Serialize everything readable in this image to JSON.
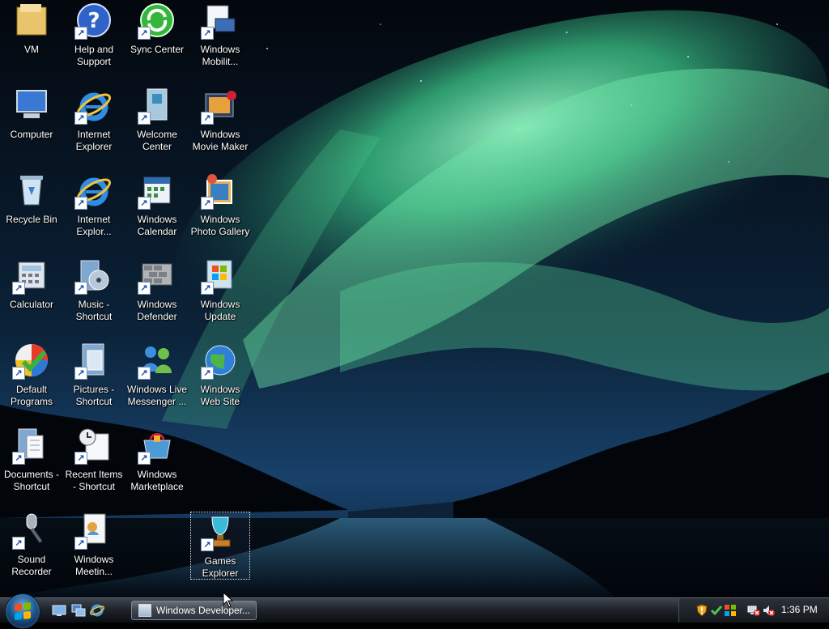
{
  "desktop": {
    "icons": [
      {
        "name": "vm-icon",
        "label": "VM",
        "shortcut": false,
        "glyph": "folder"
      },
      {
        "name": "help-support-icon",
        "label": "Help and\nSupport",
        "shortcut": true,
        "glyph": "help"
      },
      {
        "name": "sync-center-icon",
        "label": "Sync Center",
        "shortcut": true,
        "glyph": "sync"
      },
      {
        "name": "windows-mobility-icon",
        "label": "Windows\nMobilit...",
        "shortcut": true,
        "glyph": "mobility"
      },
      {
        "name": "computer-icon",
        "label": "Computer",
        "shortcut": false,
        "glyph": "computer"
      },
      {
        "name": "internet-explorer-icon",
        "label": "Internet\nExplorer",
        "shortcut": true,
        "glyph": "ie"
      },
      {
        "name": "welcome-center-icon",
        "label": "Welcome\nCenter",
        "shortcut": true,
        "glyph": "welcome"
      },
      {
        "name": "windows-movie-maker-icon",
        "label": "Windows\nMovie Maker",
        "shortcut": true,
        "glyph": "movie"
      },
      {
        "name": "recycle-bin-icon",
        "label": "Recycle Bin",
        "shortcut": false,
        "glyph": "recycle"
      },
      {
        "name": "internet-explorer-2-icon",
        "label": "Internet\nExplor...",
        "shortcut": true,
        "glyph": "ie"
      },
      {
        "name": "windows-calendar-icon",
        "label": "Windows\nCalendar",
        "shortcut": true,
        "glyph": "calendar"
      },
      {
        "name": "windows-photo-gallery-icon",
        "label": "Windows\nPhoto Gallery",
        "shortcut": true,
        "glyph": "photo"
      },
      {
        "name": "calculator-icon",
        "label": "Calculator",
        "shortcut": true,
        "glyph": "calculator"
      },
      {
        "name": "music-shortcut-icon",
        "label": "Music -\nShortcut",
        "shortcut": true,
        "glyph": "music"
      },
      {
        "name": "windows-defender-icon",
        "label": "Windows\nDefender",
        "shortcut": true,
        "glyph": "defender"
      },
      {
        "name": "windows-update-icon",
        "label": "Windows\nUpdate",
        "shortcut": true,
        "glyph": "update"
      },
      {
        "name": "default-programs-icon",
        "label": "Default\nPrograms",
        "shortcut": true,
        "glyph": "default"
      },
      {
        "name": "pictures-shortcut-icon",
        "label": "Pictures -\nShortcut",
        "shortcut": true,
        "glyph": "pictures"
      },
      {
        "name": "windows-live-messenger-icon",
        "label": "Windows Live\nMessenger ...",
        "shortcut": true,
        "glyph": "messenger"
      },
      {
        "name": "windows-web-site-icon",
        "label": "Windows\nWeb Site",
        "shortcut": true,
        "glyph": "globe"
      },
      {
        "name": "documents-shortcut-icon",
        "label": "Documents -\nShortcut",
        "shortcut": true,
        "glyph": "documents"
      },
      {
        "name": "recent-items-shortcut-icon",
        "label": "Recent Items\n- Shortcut",
        "shortcut": true,
        "glyph": "recent"
      },
      {
        "name": "windows-marketplace-icon",
        "label": "Windows\nMarketplace",
        "shortcut": true,
        "glyph": "marketplace"
      },
      {
        "name": "games-explorer-icon",
        "label": "Games\nExplorer",
        "shortcut": true,
        "glyph": "games",
        "selected": true
      },
      {
        "name": "sound-recorder-icon",
        "label": "Sound\nRecorder",
        "shortcut": true,
        "glyph": "mic"
      },
      {
        "name": "windows-meeting-icon",
        "label": "Windows\nMeetin...",
        "shortcut": true,
        "glyph": "meeting"
      }
    ]
  },
  "taskbar": {
    "start_button": "start-orb-icon",
    "quick_launch": [
      "show-desktop-icon",
      "switch-windows-icon",
      "internet-explorer-icon"
    ],
    "task_button_label": "Windows Developer...",
    "clock": "1:36 PM",
    "tray_icons": [
      "security-shield-icon",
      "network-status-icon",
      "windows-update-tray-icon",
      "network-disconnected-icon",
      "volume-muted-icon"
    ]
  },
  "colors": {
    "aurora": "#5fe0a0",
    "sky_dark": "#05101f",
    "taskbar": "#1f242b"
  }
}
